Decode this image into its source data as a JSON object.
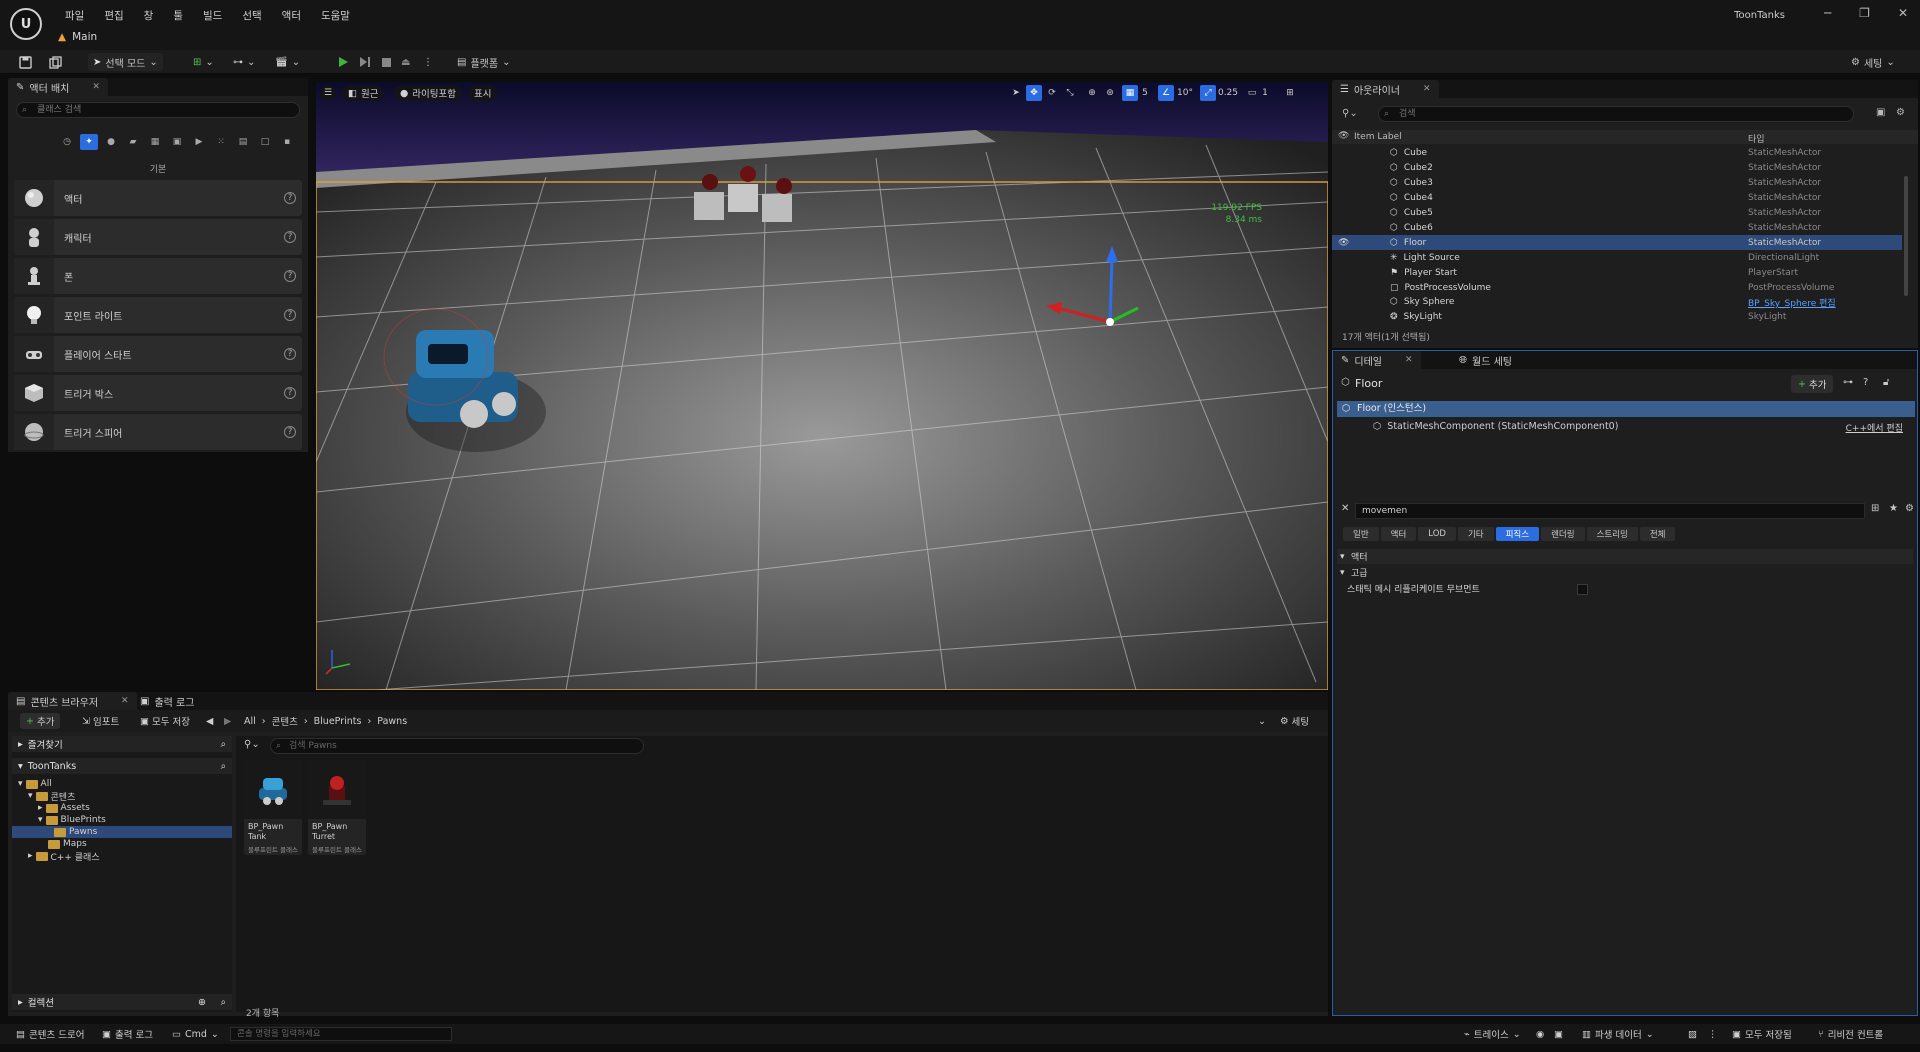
{
  "app": {
    "name": "ToonTanks",
    "level_tab": "Main",
    "menu": [
      "파일",
      "편집",
      "창",
      "툴",
      "빌드",
      "선택",
      "액터",
      "도움말"
    ]
  },
  "toolbar": {
    "select_mode": "선택 모드",
    "platforms": "플랫폼",
    "settings": "세팅"
  },
  "place_actors": {
    "tab": "액터 배치",
    "search_placeholder": "클래스 검색",
    "category": "기본",
    "items": [
      {
        "label": "액터",
        "icon": "sphere-icon"
      },
      {
        "label": "캐릭터",
        "icon": "character-icon"
      },
      {
        "label": "폰",
        "icon": "pawn-icon"
      },
      {
        "label": "포인트 라이트",
        "icon": "bulb-icon"
      },
      {
        "label": "플레이어 스타트",
        "icon": "player-start-icon"
      },
      {
        "label": "트리거 박스",
        "icon": "cube-icon"
      },
      {
        "label": "트리거 스피어",
        "icon": "sphere-icon"
      }
    ]
  },
  "viewport": {
    "perspective": "원근",
    "view_mode": "라이팅포함",
    "show": "표시",
    "grid_snap": "5",
    "rotation_snap": "10°",
    "scale_snap": "0.25",
    "camera_speed": "1",
    "fps": "119.92 FPS",
    "frame_ms": "8.34 ms"
  },
  "outliner": {
    "tab": "아웃라이너",
    "search_placeholder": "검색",
    "col_label": "Item Label",
    "col_type": "타입",
    "rows": [
      {
        "name": "Cube",
        "type": "StaticMeshActor"
      },
      {
        "name": "Cube2",
        "type": "StaticMeshActor"
      },
      {
        "name": "Cube3",
        "type": "StaticMeshActor"
      },
      {
        "name": "Cube4",
        "type": "StaticMeshActor"
      },
      {
        "name": "Cube5",
        "type": "StaticMeshActor"
      },
      {
        "name": "Cube6",
        "type": "StaticMeshActor"
      },
      {
        "name": "Floor",
        "type": "StaticMeshActor"
      },
      {
        "name": "Light Source",
        "type": "DirectionalLight"
      },
      {
        "name": "Player Start",
        "type": "PlayerStart"
      },
      {
        "name": "PostProcessVolume",
        "type": "PostProcessVolume"
      },
      {
        "name": "Sky Sphere",
        "type": "BP_Sky_Sphere 편집"
      },
      {
        "name": "SkyLight",
        "type": "SkyLight"
      }
    ],
    "count": "17개 액터(1개 선택됨)"
  },
  "details": {
    "tab": "디테일",
    "tab2": "월드 세팅",
    "title": "Floor",
    "add": "추가",
    "component_root": "Floor (인스턴스)",
    "component_child": "StaticMeshComponent (StaticMeshComponent0)",
    "cpp_edit": "C++에서 편집",
    "filter_value": "movemen",
    "category_tabs": [
      "일반",
      "액터",
      "LOD",
      "기타",
      "피직스",
      "렌더링",
      "스트리밍",
      "전체"
    ],
    "active_category": "피직스",
    "section_actor": "액터",
    "section_advanced": "고급",
    "property": "스태틱 메시 리플리케이트 무브먼트"
  },
  "content_browser": {
    "tab": "콘텐츠 브라우저",
    "tab2": "출력 로그",
    "add": "추가",
    "import": "임포트",
    "save_all": "모두 저장",
    "breadcrumb": [
      "All",
      "콘텐츠",
      "BluePrints",
      "Pawns"
    ],
    "settings": "세팅",
    "favorites": "즐겨찾기",
    "project": "ToonTanks",
    "tree": [
      "All",
      "콘텐츠",
      "Assets",
      "BluePrints",
      "Pawns",
      "Maps",
      "C++ 클래스"
    ],
    "search_placeholder": "검색 Pawns",
    "assets": [
      {
        "name": "BP_Pawn Tank",
        "type": "블루프린트 클래스"
      },
      {
        "name": "BP_Pawn Turret",
        "type": "블루프린트 클래스"
      }
    ],
    "count": "2개 항목",
    "collections": "컬렉션"
  },
  "statusbar": {
    "content_drawer": "콘텐츠 드로어",
    "output_log": "출력 로그",
    "cmd": "Cmd",
    "console_placeholder": "콘솔 명령을 입력하세요",
    "trace": "트레이스",
    "derived_data": "파생 데이터",
    "all_saved": "모두 저장됨",
    "source_control": "리비전 컨트롤"
  }
}
